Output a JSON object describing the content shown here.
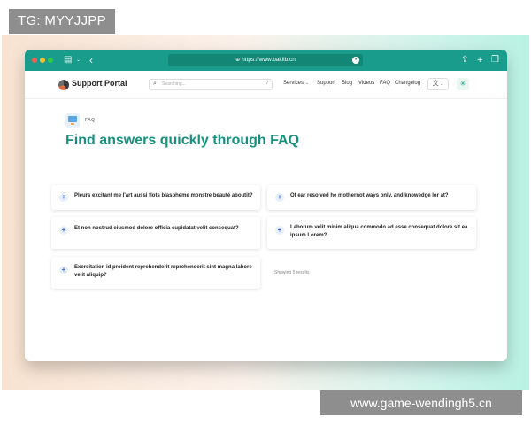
{
  "overlay": {
    "tag_label": "TG: MYYJJPP",
    "watermark": "www.game-wendingh5.cn"
  },
  "browser": {
    "url": "https://www.baklib.cn"
  },
  "header": {
    "logo_text": "Support Portal",
    "search_placeholder": "Searching...",
    "search_shortcut": "/",
    "nav": [
      "Services",
      "Support",
      "Blog",
      "Videos",
      "FAQ",
      "Changelog"
    ]
  },
  "main": {
    "section_tag": "FAQ",
    "title": "Find answers quickly through FAQ",
    "faqs": [
      "Pleurs excitant me l'art aussi flots blaspheme monstre beauté aboutit?",
      "Of ear resolved he mothernot ways only, and knowedge lor at?",
      "Et non nostrud eiusmod dolore officia cupidatat velit consequat?",
      "Laborum velit minim aliqua commodo ad esse consequat dolore sit ea ipsum Lorem?",
      "Exercitation id proident reprehenderit reprehenderit sint magna labore velit aliquip?"
    ],
    "results_text": "Showing 5 results"
  }
}
